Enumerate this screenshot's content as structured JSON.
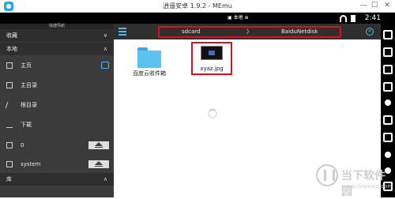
{
  "window": {
    "title": "逍遥安卓 1.9.2 - MEmu"
  },
  "statusbar": {
    "time": "2:41",
    "notif": "▣ 本地 ⊕"
  },
  "drawer": {
    "header": "快捷导航",
    "favorites": "收藏",
    "local": "本地",
    "items": [
      {
        "label": "主页"
      },
      {
        "label": "主目录"
      },
      {
        "label": "根目录"
      },
      {
        "label": "下载"
      },
      {
        "label": "0"
      },
      {
        "label": "system"
      }
    ],
    "library": "库"
  },
  "breadcrumb": {
    "part1": "sdcard",
    "separator": "〉",
    "part2": "BaiduNetdisk"
  },
  "files": [
    {
      "name": "百度云收件箱",
      "kind": "folder"
    },
    {
      "name": "xyaz.jpg",
      "kind": "image"
    }
  ],
  "watermark": {
    "text": "当下软件园",
    "url": "www.downxia.com"
  }
}
